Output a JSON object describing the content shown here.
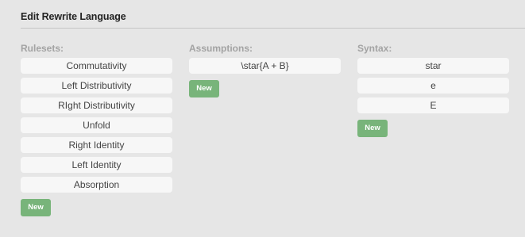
{
  "panel": {
    "title": "Edit Rewrite Language"
  },
  "rulesets": {
    "header": "Rulesets:",
    "items": [
      "Commutativity",
      "Left Distributivity",
      "RIght Distributivity",
      "Unfold",
      "Right Identity",
      "Left Identity",
      "Absorption"
    ],
    "new_label": "New"
  },
  "assumptions": {
    "header": "Assumptions:",
    "items": [
      "\\star{A + B}"
    ],
    "new_label": "New"
  },
  "syntax": {
    "header": "Syntax:",
    "items": [
      "star",
      "e",
      "E"
    ],
    "new_label": "New"
  },
  "colors": {
    "background": "#e6e6e6",
    "item_background": "#f7f7f7",
    "button_green": "#78b47a",
    "header_gray": "#a3a3a3"
  }
}
